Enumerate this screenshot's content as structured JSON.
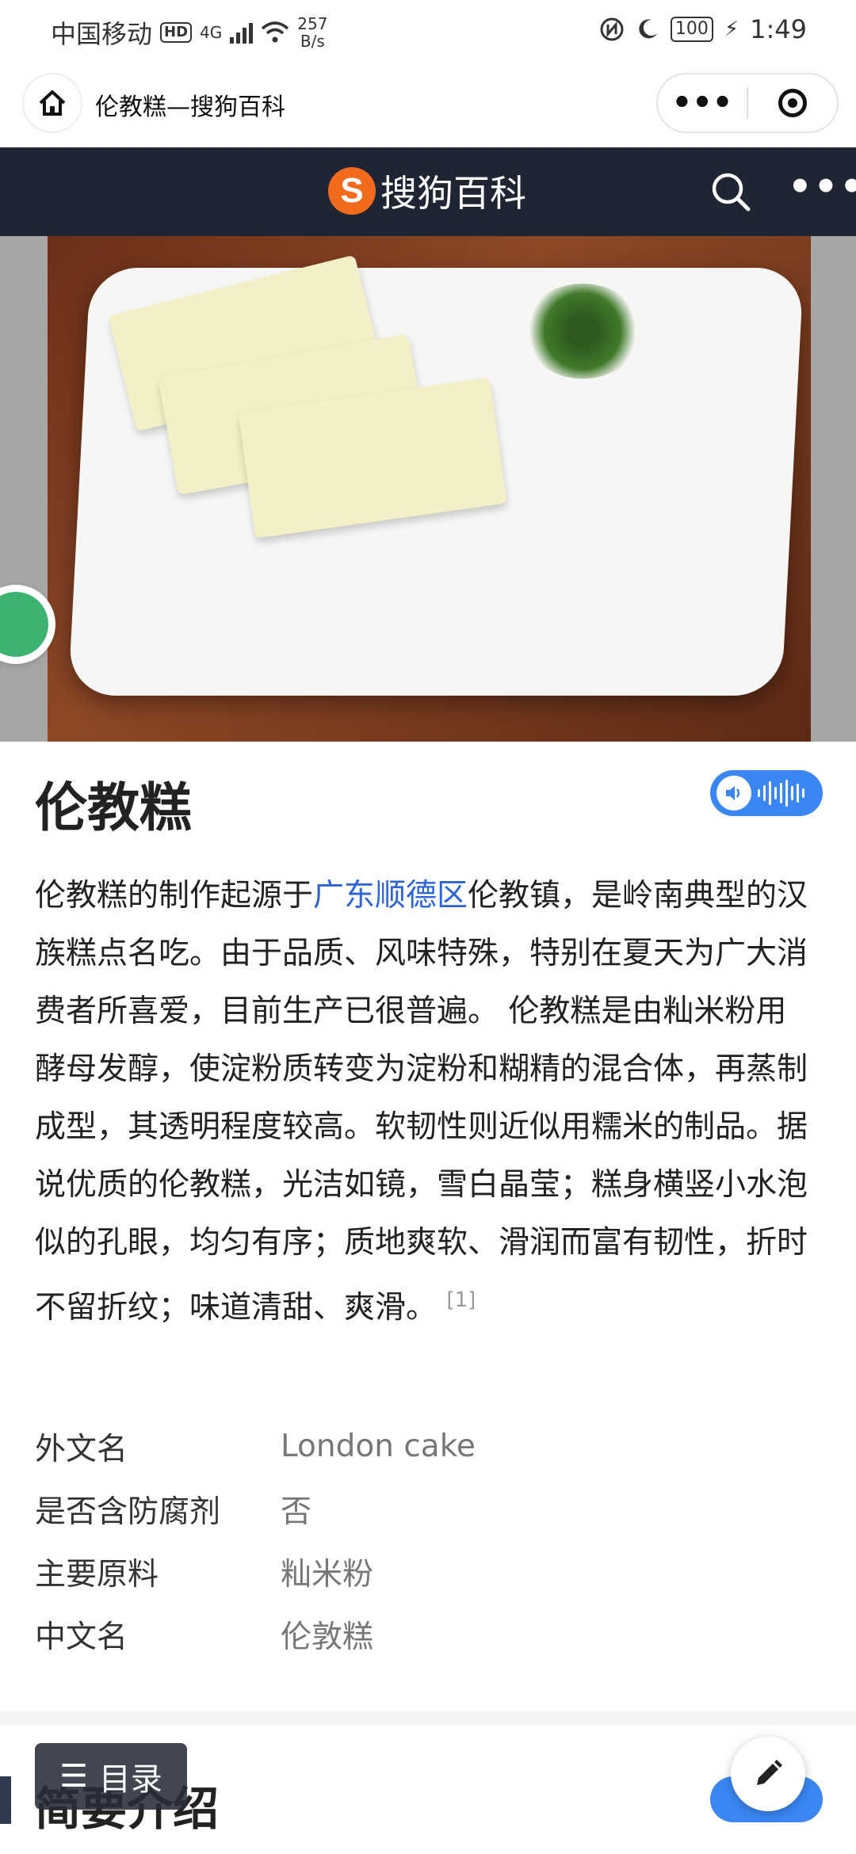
{
  "status_bar": {
    "carrier": "中国移动",
    "hd": "HD",
    "network": "4G",
    "speed_value": "257",
    "speed_unit": "B/s",
    "battery": "100",
    "time": "1:49"
  },
  "navbar": {
    "title": "伦教糕—搜狗百科",
    "more_label": "•••"
  },
  "header": {
    "logo_mark": "S",
    "logo_text": "搜狗百科",
    "more_label": "•••"
  },
  "article": {
    "title": "伦教糕",
    "summary_part1": "伦教糕的制作起源于",
    "summary_link": "广东顺德区",
    "summary_part2": "伦教镇，是岭南典型的汉族糕点名吃。由于品质、风味特殊，特别在夏天为广大消费者所喜爱，目前生产已很普遍。 伦教糕是由籼米粉用酵母发醇，使淀粉质转变为淀粉和糊精的混合体，再蒸制成型，其透明程度较高。软韧性则近似用糯米的制品。据说优质的伦教糕，光洁如镜，雪白晶莹；糕身横竖小水泡似的孔眼，均匀有序；质地爽软、滑润而富有韧性，折时不留折纹；味道清甜、爽滑。",
    "reference": "[1]"
  },
  "infobox": [
    {
      "key": "外文名",
      "value": "London cake"
    },
    {
      "key": "是否含防腐剂",
      "value": "否"
    },
    {
      "key": "主要原料",
      "value": "籼米粉"
    },
    {
      "key": "中文名",
      "value": "伦敦糕"
    }
  ],
  "section": {
    "title": "简要介绍"
  },
  "toc_button": {
    "icon": "☰",
    "label": "目录"
  },
  "colors": {
    "header_bg": "#1f2533",
    "brand_orange": "#f26b1d",
    "link_blue": "#2c64d8",
    "audio_blue": "#3a87f4"
  },
  "icons": [
    "home-icon",
    "more-icon",
    "close-target-icon",
    "search-icon",
    "wechat-share-icon",
    "speaker-icon",
    "edit-pencil-icon",
    "menu-icon"
  ]
}
